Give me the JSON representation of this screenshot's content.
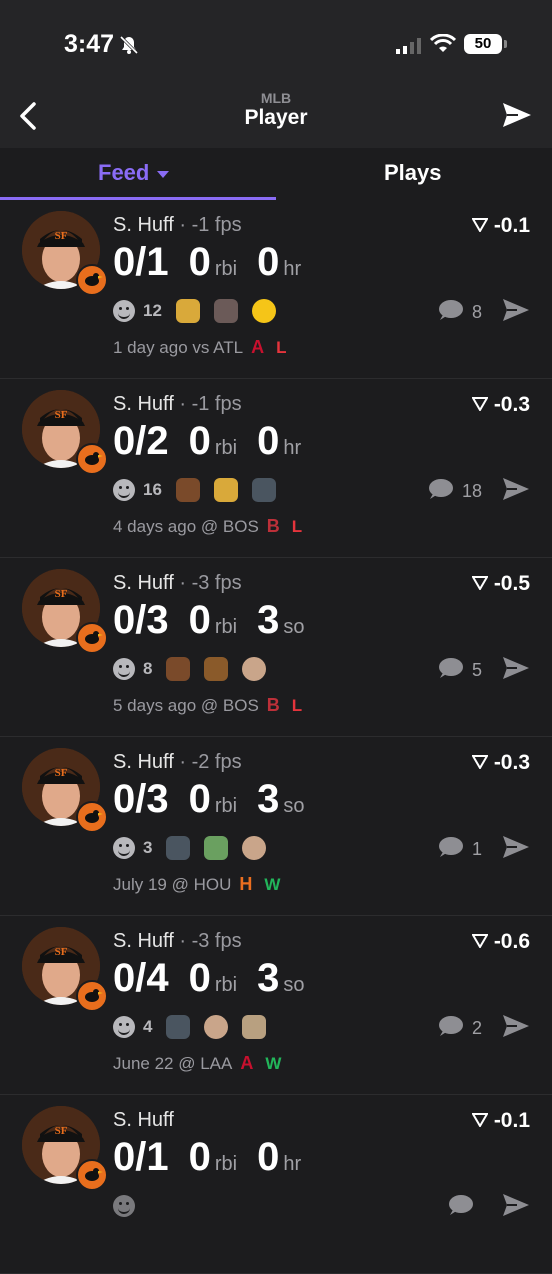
{
  "status": {
    "time": "3:47",
    "battery": "50"
  },
  "nav": {
    "subtitle": "MLB",
    "title": "Player"
  },
  "tabs": [
    {
      "label": "Feed",
      "active": true
    },
    {
      "label": "Plays",
      "active": false
    }
  ],
  "colors": {
    "accent": "#8a6cf5",
    "loss": "#e5343c",
    "win": "#22b55a"
  },
  "cards": [
    {
      "name": "S. Huff",
      "fps": "-1 fps",
      "delta": "-0.1",
      "ab": "0/1",
      "rbi": "0",
      "rbi_label": "rbi",
      "stat3": "0",
      "stat3_label": "hr",
      "reaction_count": "12",
      "emojis": [
        "middle-finger",
        "skull-tattoo",
        "laughing-face"
      ],
      "comments": "8",
      "when": "1 day ago vs ATL",
      "opponent_logo": "A",
      "result": "L"
    },
    {
      "name": "S. Huff",
      "fps": "-1 fps",
      "delta": "-0.3",
      "ab": "0/2",
      "rbi": "0",
      "rbi_label": "rbi",
      "stat3": "0",
      "stat3_label": "hr",
      "reaction_count": "16",
      "emojis": [
        "poop",
        "middle-finger",
        "player-sticker"
      ],
      "comments": "18",
      "when": "4 days ago @ BOS",
      "opponent_logo": "B",
      "result": "L"
    },
    {
      "name": "S. Huff",
      "fps": "-3 fps",
      "delta": "-0.5",
      "ab": "0/3",
      "rbi": "0",
      "rbi_label": "rbi",
      "stat3": "3",
      "stat3_label": "so",
      "reaction_count": "8",
      "emojis": [
        "poop",
        "dancing-character",
        "bald-man"
      ],
      "comments": "5",
      "when": "5 days ago @ BOS",
      "opponent_logo": "B",
      "result": "L"
    },
    {
      "name": "S. Huff",
      "fps": "-2 fps",
      "delta": "-0.3",
      "ab": "0/3",
      "rbi": "0",
      "rbi_label": "rbi",
      "stat3": "3",
      "stat3_label": "so",
      "reaction_count": "3",
      "emojis": [
        "player-sticker",
        "baby",
        "bald-man"
      ],
      "comments": "1",
      "when": "July 19 @ HOU",
      "opponent_logo": "H",
      "result": "W"
    },
    {
      "name": "S. Huff",
      "fps": "-3 fps",
      "delta": "-0.6",
      "ab": "0/4",
      "rbi": "0",
      "rbi_label": "rbi",
      "stat3": "3",
      "stat3_label": "so",
      "reaction_count": "4",
      "emojis": [
        "player-sticker",
        "bald-man",
        "dancer"
      ],
      "comments": "2",
      "when": "June 22 @ LAA",
      "opponent_logo": "A",
      "result": "W"
    },
    {
      "name": "S. Huff",
      "fps": "",
      "delta": "-0.1",
      "ab": "0/1",
      "rbi": "0",
      "rbi_label": "rbi",
      "stat3": "0",
      "stat3_label": "hr",
      "reaction_count": "",
      "emojis": [],
      "comments": "",
      "when": "",
      "opponent_logo": "",
      "result": ""
    }
  ]
}
